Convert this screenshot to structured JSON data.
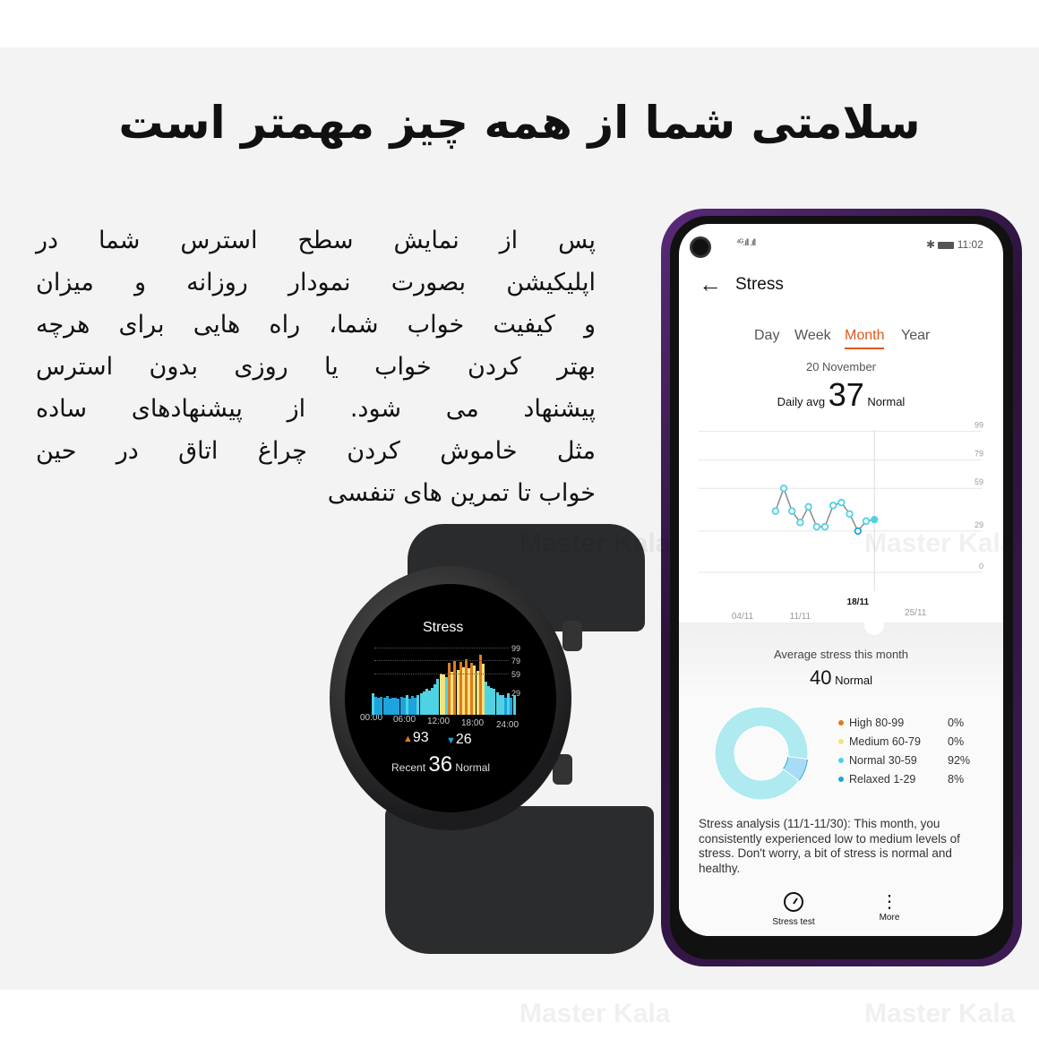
{
  "headline": "سلامتی شما از همه چیز مهمتر است",
  "paragraph": [
    "پس از نمایش سطح استرس شما در",
    "اپلیکیشن بصورت نمودار روزانه و میزان",
    "و کیفیت خواب شما، راه هایی برای هرچه",
    "بهتر کردن خواب یا روزی بدون استرس",
    "پیشنهاد می شود. از پیشنهادهای ساده",
    "مثل خاموش کردن چراغ اتاق در حین",
    "خواب تا تمرین های تنفسی"
  ],
  "watermark": "Master Kala",
  "watch": {
    "title": "Stress",
    "y_ticks": [
      "99",
      "79",
      "59",
      "29"
    ],
    "x_ticks": [
      "00:00",
      "06:00",
      "12:00",
      "18:00",
      "24:00"
    ],
    "max": "93",
    "min": "26",
    "recent_label": "Recent",
    "recent_value": "36",
    "recent_status": "Normal",
    "bars": [
      33,
      28,
      27,
      28,
      26,
      29,
      25,
      27,
      26,
      25,
      28,
      26,
      31,
      25,
      29,
      27,
      31,
      33,
      36,
      40,
      38,
      42,
      47,
      55,
      64,
      62,
      58,
      80,
      66,
      84,
      70,
      82,
      74,
      86,
      72,
      80,
      76,
      68,
      93,
      79,
      51,
      45,
      41,
      40,
      35,
      30,
      30,
      26,
      34,
      26,
      31
    ],
    "colors": {
      "relaxed": "#1fa3dc",
      "normal": "#4fd2e4",
      "medium": "#f4e27a",
      "high": "#e07b1e"
    }
  },
  "phone": {
    "status": {
      "signal": "signal-icon",
      "bluetooth": "bluetooth-icon",
      "battery": "battery-icon",
      "time": "11:02"
    },
    "header": {
      "back": "back-arrow-icon",
      "title": "Stress"
    },
    "tabs": [
      {
        "label": "Day"
      },
      {
        "label": "Week"
      },
      {
        "label": "Month",
        "active": true
      },
      {
        "label": "Year"
      }
    ],
    "accent": "#e0571c",
    "date": "20 November",
    "daily_avg_label": "Daily avg",
    "daily_avg_value": "37",
    "daily_avg_status": "Normal",
    "chart_data": {
      "type": "line",
      "y_ticks": [
        0,
        29,
        59,
        79,
        99
      ],
      "ylim": [
        0,
        99
      ],
      "x_ticks": [
        "04/11",
        "11/11",
        "18/11",
        "25/11"
      ],
      "selected_tick": "18/11",
      "x_days": [
        8,
        9,
        10,
        11,
        12,
        13,
        14,
        15,
        16,
        17,
        18,
        19,
        20
      ],
      "values": [
        43,
        59,
        43,
        35,
        46,
        32,
        32,
        47,
        49,
        41,
        29,
        36,
        37
      ],
      "point_color": "#4fd2e4",
      "line_color": "#8a8a8a"
    },
    "average": {
      "label": "Average stress this month",
      "value": "40",
      "status": "Normal"
    },
    "distribution": [
      {
        "label": "High 80-99",
        "percent": "0%",
        "value": 0,
        "color": "#e07b1e"
      },
      {
        "label": "Medium 60-79",
        "percent": "0%",
        "value": 0,
        "color": "#f4e27a"
      },
      {
        "label": "Normal 30-59",
        "percent": "92%",
        "value": 92,
        "color": "#4fd2e4"
      },
      {
        "label": "Relaxed 1-29",
        "percent": "8%",
        "value": 8,
        "color": "#1fa3dc"
      }
    ],
    "analysis": "Stress analysis (11/1-11/30): This month, you consistently experienced low to medium levels of stress. Don't worry, a bit of stress is normal and healthy.",
    "bottom": [
      {
        "label": "Stress test",
        "icon": "gauge-icon"
      },
      {
        "label": "More",
        "icon": "more-vertical-icon"
      }
    ]
  }
}
